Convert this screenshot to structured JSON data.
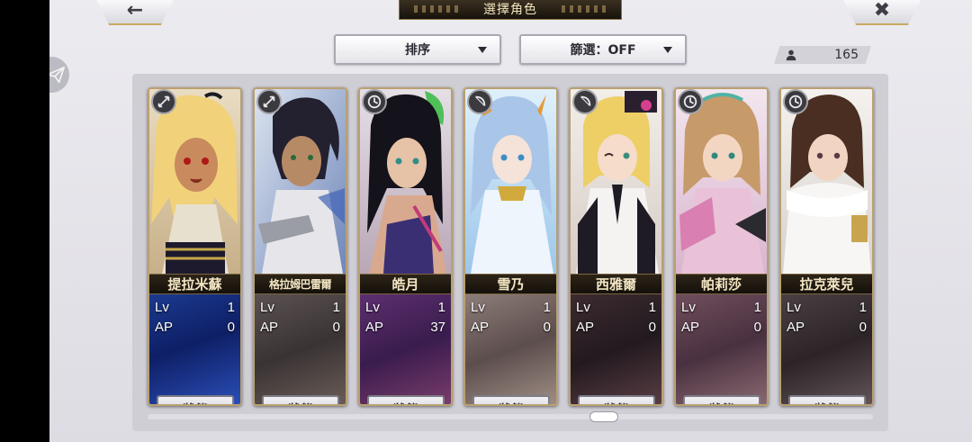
{
  "header": {
    "title": "選擇角色",
    "back_icon": "arrow-left-icon",
    "close_icon": "close-icon"
  },
  "toolbar": {
    "sort_label": "排序",
    "filter_label": "篩選：OFF",
    "character_count": "165"
  },
  "colors": {
    "gold_border": "#b9a070",
    "name_plate": "#1c1710",
    "stat_text": "#ffffff"
  },
  "cards": [
    {
      "name": "提拉米蘇",
      "lv_label": "Lv",
      "lv": "1",
      "ap_label": "AP",
      "ap": "0",
      "status": "狀態",
      "type_icon": "arrow-icon"
    },
    {
      "name": "格拉姆巴雷爾",
      "lv_label": "Lv",
      "lv": "1",
      "ap_label": "AP",
      "ap": "0",
      "status": "狀態",
      "type_icon": "arrow-icon"
    },
    {
      "name": "皓月",
      "lv_label": "Lv",
      "lv": "1",
      "ap_label": "AP",
      "ap": "37",
      "status": "狀態",
      "type_icon": "clock-icon"
    },
    {
      "name": "雪乃",
      "lv_label": "Lv",
      "lv": "1",
      "ap_label": "AP",
      "ap": "0",
      "status": "狀態",
      "type_icon": "bow-icon"
    },
    {
      "name": "西雅爾",
      "lv_label": "Lv",
      "lv": "1",
      "ap_label": "AP",
      "ap": "0",
      "status": "狀態",
      "type_icon": "bow-icon"
    },
    {
      "name": "帕莉莎",
      "lv_label": "Lv",
      "lv": "1",
      "ap_label": "AP",
      "ap": "0",
      "status": "狀態",
      "type_icon": "clock-icon"
    },
    {
      "name": "拉克萊兒",
      "lv_label": "Lv",
      "lv": "1",
      "ap_label": "AP",
      "ap": "0",
      "status": "狀態",
      "type_icon": "clock-icon"
    }
  ]
}
